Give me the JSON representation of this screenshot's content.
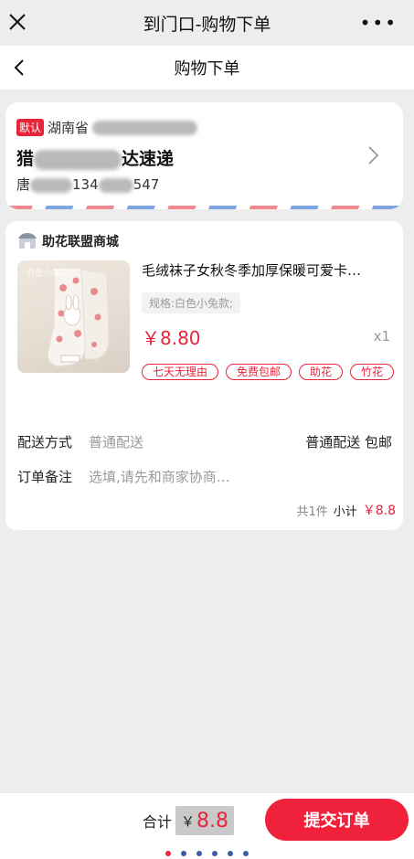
{
  "window": {
    "title": "到门口-购物下单",
    "more": "•••"
  },
  "navbar": {
    "title": "购物下单"
  },
  "address": {
    "default_tag": "默认",
    "province": "湖南省",
    "name_prefix": "猎",
    "name_suffix": "达速递",
    "contact_prefix": "唐",
    "phone_part1": "134",
    "phone_part2": "547"
  },
  "store": {
    "name": "助花联盟商城"
  },
  "product": {
    "thumb_label": "白色小兔款",
    "title": "毛绒袜子女秋冬季加厚保暖可爱卡…",
    "spec": "规格:白色小兔款;",
    "price": "￥8.80",
    "qty": "x1",
    "tags": [
      "七天无理由",
      "免费包邮",
      "助花",
      "竹花"
    ]
  },
  "delivery": {
    "label": "配送方式",
    "value": "普通配送",
    "right": "普通配送 包邮"
  },
  "remark": {
    "label": "订单备注",
    "placeholder": "选填,请先和商家协商…"
  },
  "subtotal": {
    "count": "共1件",
    "label": "小计",
    "amount": "￥8.8"
  },
  "footer": {
    "total_label": "合计",
    "currency": "￥",
    "total_value": "8.8",
    "submit_label": "提交订单"
  },
  "pager": {
    "count": 6,
    "active_index": 0
  },
  "colors": {
    "accent": "#e8243b",
    "stripe_red": "#f0888d",
    "stripe_blue": "#7ea4e6",
    "dot_blue": "#3d5ba9"
  }
}
